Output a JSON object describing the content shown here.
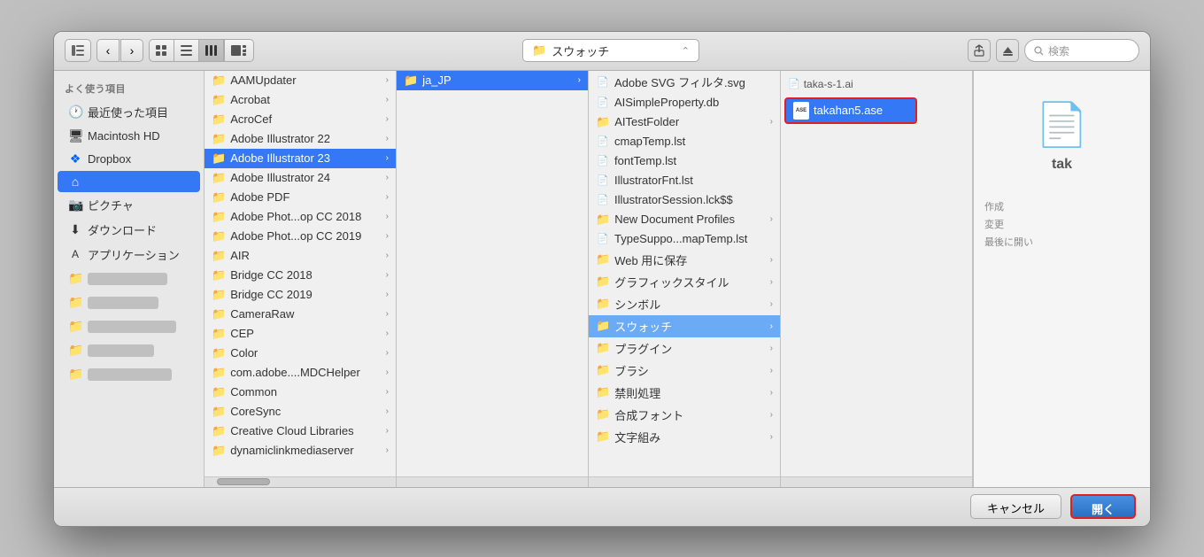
{
  "toolbar": {
    "back_label": "‹",
    "forward_label": "›",
    "view_icons": "⊞",
    "view_list": "☰",
    "view_columns": "⦿",
    "view_gallery": "⊟▾",
    "location": "スウォッチ",
    "search_placeholder": "検索",
    "share_icon": "↑",
    "eject_icon": "⏏"
  },
  "sidebar": {
    "section_label": "よく使う項目",
    "items": [
      {
        "id": "recents",
        "icon": "🕐",
        "label": "最近使った項目"
      },
      {
        "id": "macintosh",
        "icon": "🖥",
        "label": "Macintosh HD"
      },
      {
        "id": "dropbox",
        "icon": "📦",
        "label": "Dropbox"
      },
      {
        "id": "home",
        "icon": "🏠",
        "label": ""
      },
      {
        "id": "pictures",
        "icon": "📷",
        "label": "ピクチャ"
      },
      {
        "id": "downloads",
        "icon": "⬇",
        "label": "ダウンロード"
      },
      {
        "id": "applications",
        "icon": "🔤",
        "label": "アプリケーション"
      }
    ]
  },
  "column1": {
    "items": [
      {
        "id": "aamupdater",
        "label": "AAMUpdater",
        "type": "folder",
        "hasChildren": true
      },
      {
        "id": "acrobat",
        "label": "Acrobat",
        "type": "folder",
        "hasChildren": true
      },
      {
        "id": "acrocef",
        "label": "AcroCef",
        "type": "folder",
        "hasChildren": true
      },
      {
        "id": "ai22",
        "label": "Adobe Illustrator 22",
        "type": "folder",
        "hasChildren": true
      },
      {
        "id": "ai23",
        "label": "Adobe Illustrator 23",
        "type": "folder",
        "hasChildren": true,
        "selected": true
      },
      {
        "id": "ai24",
        "label": "Adobe Illustrator 24",
        "type": "folder",
        "hasChildren": true
      },
      {
        "id": "adobepdf",
        "label": "Adobe PDF",
        "type": "folder",
        "hasChildren": true
      },
      {
        "id": "photoshop2018",
        "label": "Adobe Phot...op CC 2018",
        "type": "folder",
        "hasChildren": true
      },
      {
        "id": "photoshop2019",
        "label": "Adobe Phot...op CC 2019",
        "type": "folder",
        "hasChildren": true
      },
      {
        "id": "air",
        "label": "AIR",
        "type": "folder",
        "hasChildren": true
      },
      {
        "id": "bridgecc2018",
        "label": "Bridge CC 2018",
        "type": "folder",
        "hasChildren": true
      },
      {
        "id": "bridgecc2019",
        "label": "Bridge CC 2019",
        "type": "folder",
        "hasChildren": true
      },
      {
        "id": "cameraraw",
        "label": "CameraRaw",
        "type": "folder",
        "hasChildren": true
      },
      {
        "id": "cep",
        "label": "CEP",
        "type": "folder",
        "hasChildren": true
      },
      {
        "id": "color",
        "label": "Color",
        "type": "folder",
        "hasChildren": true
      },
      {
        "id": "comadobe",
        "label": "com.adobe....MDCHelper",
        "type": "folder",
        "hasChildren": true
      },
      {
        "id": "common",
        "label": "Common",
        "type": "folder",
        "hasChildren": true
      },
      {
        "id": "coresync",
        "label": "CoreSync",
        "type": "folder",
        "hasChildren": true
      },
      {
        "id": "cclibraries",
        "label": "Creative Cloud Libraries",
        "type": "folder",
        "hasChildren": true
      },
      {
        "id": "dynamiclink",
        "label": "dynamiclinkmediaserver",
        "type": "folder",
        "hasChildren": true
      }
    ]
  },
  "column2": {
    "items": [
      {
        "id": "jajp",
        "label": "ja_JP",
        "type": "folder",
        "hasChildren": true,
        "selected": true
      }
    ]
  },
  "column3": {
    "items": [
      {
        "id": "svgfilter",
        "label": "Adobe SVG フィルタ.svg",
        "type": "file",
        "hasChildren": false
      },
      {
        "id": "aisimpleprop",
        "label": "AISimpleProperty.db",
        "type": "file",
        "hasChildren": false
      },
      {
        "id": "aitestfolder",
        "label": "AITestFolder",
        "type": "folder",
        "hasChildren": true
      },
      {
        "id": "cmaptemp",
        "label": "cmapTemp.lst",
        "type": "file",
        "hasChildren": false
      },
      {
        "id": "fonttemp",
        "label": "fontTemp.lst",
        "type": "file",
        "hasChildren": false
      },
      {
        "id": "illustratorfnt",
        "label": "IllustratorFnt.lst",
        "type": "file",
        "hasChildren": false
      },
      {
        "id": "illustratorsession",
        "label": "IllustratorSession.lck$$",
        "type": "file",
        "hasChildren": false
      },
      {
        "id": "newdocprofiles",
        "label": "New Document Profiles",
        "type": "folder",
        "hasChildren": true
      },
      {
        "id": "typesuppo",
        "label": "TypeSuppo...mapTemp.lst",
        "type": "file",
        "hasChildren": false
      },
      {
        "id": "websave",
        "label": "Web 用に保存",
        "type": "folder",
        "hasChildren": true
      },
      {
        "id": "graphicstyles",
        "label": "グラフィックスタイル",
        "type": "folder",
        "hasChildren": true
      },
      {
        "id": "symbol",
        "label": "シンボル",
        "type": "folder",
        "hasChildren": true
      },
      {
        "id": "swatches",
        "label": "スウォッチ",
        "type": "folder",
        "hasChildren": true,
        "selected": true
      },
      {
        "id": "plugins",
        "label": "プラグイン",
        "type": "folder",
        "hasChildren": true
      },
      {
        "id": "brushes",
        "label": "ブラシ",
        "type": "folder",
        "hasChildren": true
      },
      {
        "id": "kinshi",
        "label": "禁則処理",
        "type": "folder",
        "hasChildren": true
      },
      {
        "id": "gosei",
        "label": "合成フォント",
        "type": "folder",
        "hasChildren": true
      },
      {
        "id": "mojigumi",
        "label": "文字組み",
        "type": "folder",
        "hasChildren": true
      }
    ]
  },
  "column4": {
    "selected_file": {
      "name": "takahan5.ase",
      "icon_text": "ASE"
    },
    "prev_file": "taka-s-1.ai"
  },
  "preview": {
    "filename": "tak",
    "meta_created": "作成",
    "meta_modified": "変更",
    "meta_opened": "最後に開い"
  },
  "bottom": {
    "cancel_label": "キャンセル",
    "open_label": "開く"
  }
}
